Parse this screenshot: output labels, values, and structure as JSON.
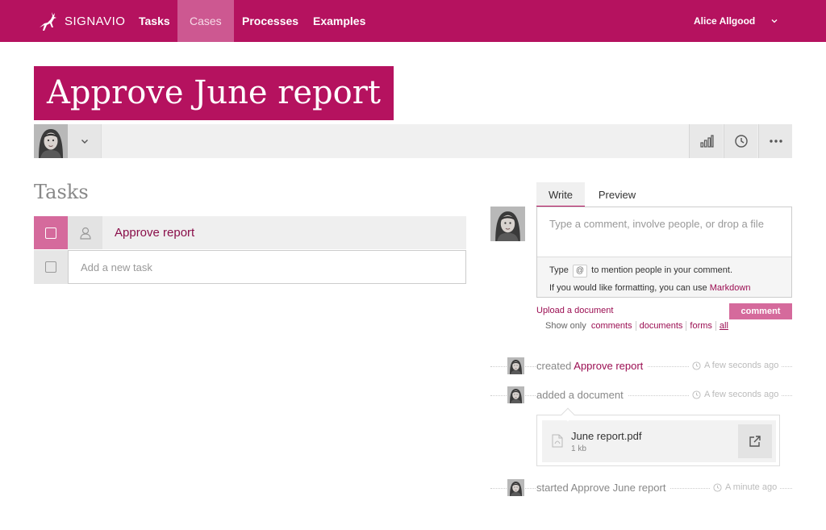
{
  "nav": {
    "logo_text": "SIGNAVIO",
    "items": [
      {
        "label": "Tasks"
      },
      {
        "label": "Cases"
      },
      {
        "label": "Processes"
      },
      {
        "label": "Examples"
      }
    ],
    "active_item": "Cases",
    "user_name": "Alice Allgood",
    "brand_color": "#b5125f"
  },
  "case": {
    "title": "Approve June report"
  },
  "toolbar": {
    "icons": [
      "avatar",
      "chevron-down-icon",
      "bar-chart-icon",
      "clock-icon",
      "more-icon"
    ]
  },
  "tasks": {
    "heading": "Tasks",
    "items": [
      {
        "label": "Approve report",
        "done": false
      }
    ],
    "new_task_placeholder": "Add a new task"
  },
  "comment": {
    "tabs": {
      "write": "Write",
      "preview": "Preview"
    },
    "active_tab": "Write",
    "placeholder": "Type a comment, involve people, or drop a file",
    "hint_type": "Type",
    "hint_at": "@",
    "hint_mention": "to mention people in your comment.",
    "hint_formatting": "If you would like formatting, you can use",
    "hint_markdown": "Markdown",
    "upload_label": "Upload a document",
    "submit_label": "comment",
    "filter": {
      "label": "Show only",
      "options": [
        "comments",
        "documents",
        "forms",
        "all"
      ],
      "selected": "all"
    }
  },
  "activity": [
    {
      "verb": "created",
      "target": "Approve report",
      "time": "A few seconds ago"
    },
    {
      "verb": "added a document",
      "target": "",
      "time": "A few seconds ago",
      "document": {
        "name": "June report.pdf",
        "size": "1 kb"
      }
    },
    {
      "verb": "started Approve June report",
      "target": "",
      "time": "A minute ago"
    }
  ]
}
